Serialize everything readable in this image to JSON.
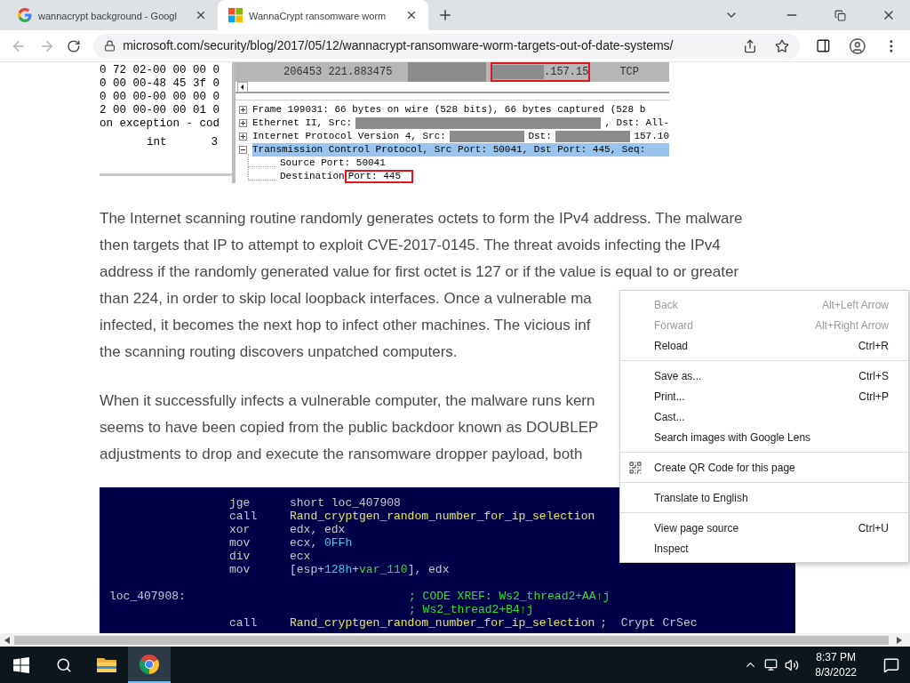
{
  "browser": {
    "tabs": [
      {
        "kind": "google",
        "title": "wannacrypt background - Googl",
        "selected": false
      },
      {
        "kind": "microsoft",
        "title": "WannaCrypt ransomware worm",
        "selected": true
      }
    ],
    "url": "microsoft.com/security/blog/2017/05/12/wannacrypt-ransomware-worm-targets-out-of-date-systems/"
  },
  "article": {
    "packet_capture": {
      "hex_pane": [
        [
          "0 72 02-00 00 00 0"
        ],
        [
          "0 00 00-48 45 3f 0"
        ],
        [
          "0 00 00-00 00 00 0"
        ],
        [
          "2 00 00-00 00 01 0"
        ],
        [
          "on exception - cod"
        ],
        [
          "int",
          "3"
        ]
      ],
      "packet_row": {
        "number_time": "206453 221.883475",
        "destination": ".157.15",
        "protocol": "TCP"
      },
      "detail_tree": [
        {
          "expanded": false,
          "selected": false,
          "segments": [
            {
              "kind": "text",
              "text": "Frame 199031: 66 bytes on wire (528 bits), 66 bytes captured (528 b"
            }
          ]
        },
        {
          "expanded": false,
          "selected": false,
          "segments": [
            {
              "kind": "text",
              "text": "Ethernet II, Src:"
            },
            {
              "kind": "redacted"
            },
            {
              "kind": "text",
              "text": ", Dst: All-"
            }
          ]
        },
        {
          "expanded": false,
          "selected": false,
          "segments": [
            {
              "kind": "text",
              "text": "Internet Protocol Version 4, Src:"
            },
            {
              "kind": "redacted"
            },
            {
              "kind": "text",
              "text": "Dst:"
            },
            {
              "kind": "redacted"
            },
            {
              "kind": "text",
              "text": "157.10"
            }
          ]
        },
        {
          "expanded": true,
          "selected": true,
          "segments": [
            {
              "kind": "text",
              "text": "Transmission Control Protocol, Src Port: 50041, Dst Port: 445, Seq:"
            }
          ],
          "children": [
            {
              "segments": [
                {
                  "kind": "text",
                  "text": "Source Port: 50041"
                }
              ]
            },
            {
              "segments": [
                {
                  "kind": "text",
                  "text": "Destination"
                },
                {
                  "kind": "boxed",
                  "text": "Port: 445"
                }
              ]
            }
          ]
        }
      ]
    },
    "paragraphs": [
      {
        "lines": [
          "The Internet scanning routine randomly generates octets to form the IPv4 address. The malware",
          "then targets that IP to attempt to exploit CVE-2017-0145. The threat avoids infecting the IPv4",
          "address if the randomly generated value for first octet is 127 or if the value is equal to or greater",
          "than 224, in order to skip local loopback interfaces. Once a vulnerable ma",
          "infected, it becomes the next hop to infect other machines. The vicious inf",
          "the scanning routing discovers unpatched computers."
        ]
      },
      {
        "lines": [
          "When it successfully infects a vulnerable computer, the malware runs kern",
          "seems to have been copied from the public backdoor known as DOUBLEP",
          "adjustments to drop and execute the ransomware dropper payload, both"
        ]
      }
    ],
    "disassembly": [
      {
        "mnemonic": "jge",
        "operands": [
          {
            "kind": "plain",
            "text": "short loc_407908"
          }
        ]
      },
      {
        "mnemonic": "call",
        "operands": [
          {
            "kind": "function",
            "text": "Rand_cryptgen_random_number_for_ip_selection"
          }
        ]
      },
      {
        "mnemonic": "xor",
        "operands": [
          {
            "kind": "plain",
            "text": "edx, edx"
          }
        ]
      },
      {
        "mnemonic": "mov",
        "operands": [
          {
            "kind": "plain",
            "text": "ecx, "
          },
          {
            "kind": "number",
            "text": "0FFh"
          }
        ]
      },
      {
        "mnemonic": "div",
        "operands": [
          {
            "kind": "plain",
            "text": "ecx"
          }
        ]
      },
      {
        "mnemonic": "mov",
        "operands": [
          {
            "kind": "plain",
            "text": "[esp+"
          },
          {
            "kind": "number",
            "text": "128h"
          },
          {
            "kind": "plain",
            "text": "+"
          },
          {
            "kind": "variable",
            "text": "var_110"
          },
          {
            "kind": "plain",
            "text": "], edx"
          }
        ]
      },
      {
        "label": "loc_407908:",
        "comment": {
          "kind": "xref",
          "text": "; CODE XREF: Ws2_thread2+AA↑j"
        }
      },
      {
        "comment": {
          "kind": "xref",
          "text": "; Ws2_thread2+B4↑j"
        }
      },
      {
        "mnemonic": "call",
        "operands": [
          {
            "kind": "function",
            "text": "Rand_cryptgen_random_number_for_ip_selection"
          }
        ],
        "comment": {
          "kind": "note",
          "text": ";  Crypt CrSec"
        }
      }
    ]
  },
  "context_menu": {
    "groups": [
      [
        {
          "label": "Back",
          "shortcut": "Alt+Left Arrow",
          "disabled": true
        },
        {
          "label": "Forward",
          "shortcut": "Alt+Right Arrow",
          "disabled": true
        },
        {
          "label": "Reload",
          "shortcut": "Ctrl+R",
          "disabled": false
        }
      ],
      [
        {
          "label": "Save as...",
          "shortcut": "Ctrl+S",
          "disabled": false
        },
        {
          "label": "Print...",
          "shortcut": "Ctrl+P",
          "disabled": false
        },
        {
          "label": "Cast...",
          "disabled": false
        },
        {
          "label": "Search images with Google Lens",
          "disabled": false
        }
      ],
      [
        {
          "kind": "qr",
          "label": "Create QR Code for this page",
          "disabled": false
        }
      ],
      [
        {
          "label": "Translate to English",
          "disabled": false
        }
      ],
      [
        {
          "label": "View page source",
          "shortcut": "Ctrl+U",
          "disabled": false
        },
        {
          "label": "Inspect",
          "disabled": false
        }
      ]
    ]
  },
  "taskbar": {
    "buttons": [
      {
        "kind": "start",
        "selected": false
      },
      {
        "kind": "search",
        "selected": false
      },
      {
        "kind": "files",
        "selected": false
      },
      {
        "kind": "chrome",
        "selected": true
      }
    ],
    "time": "8:37 PM",
    "date": "8/3/2022"
  }
}
